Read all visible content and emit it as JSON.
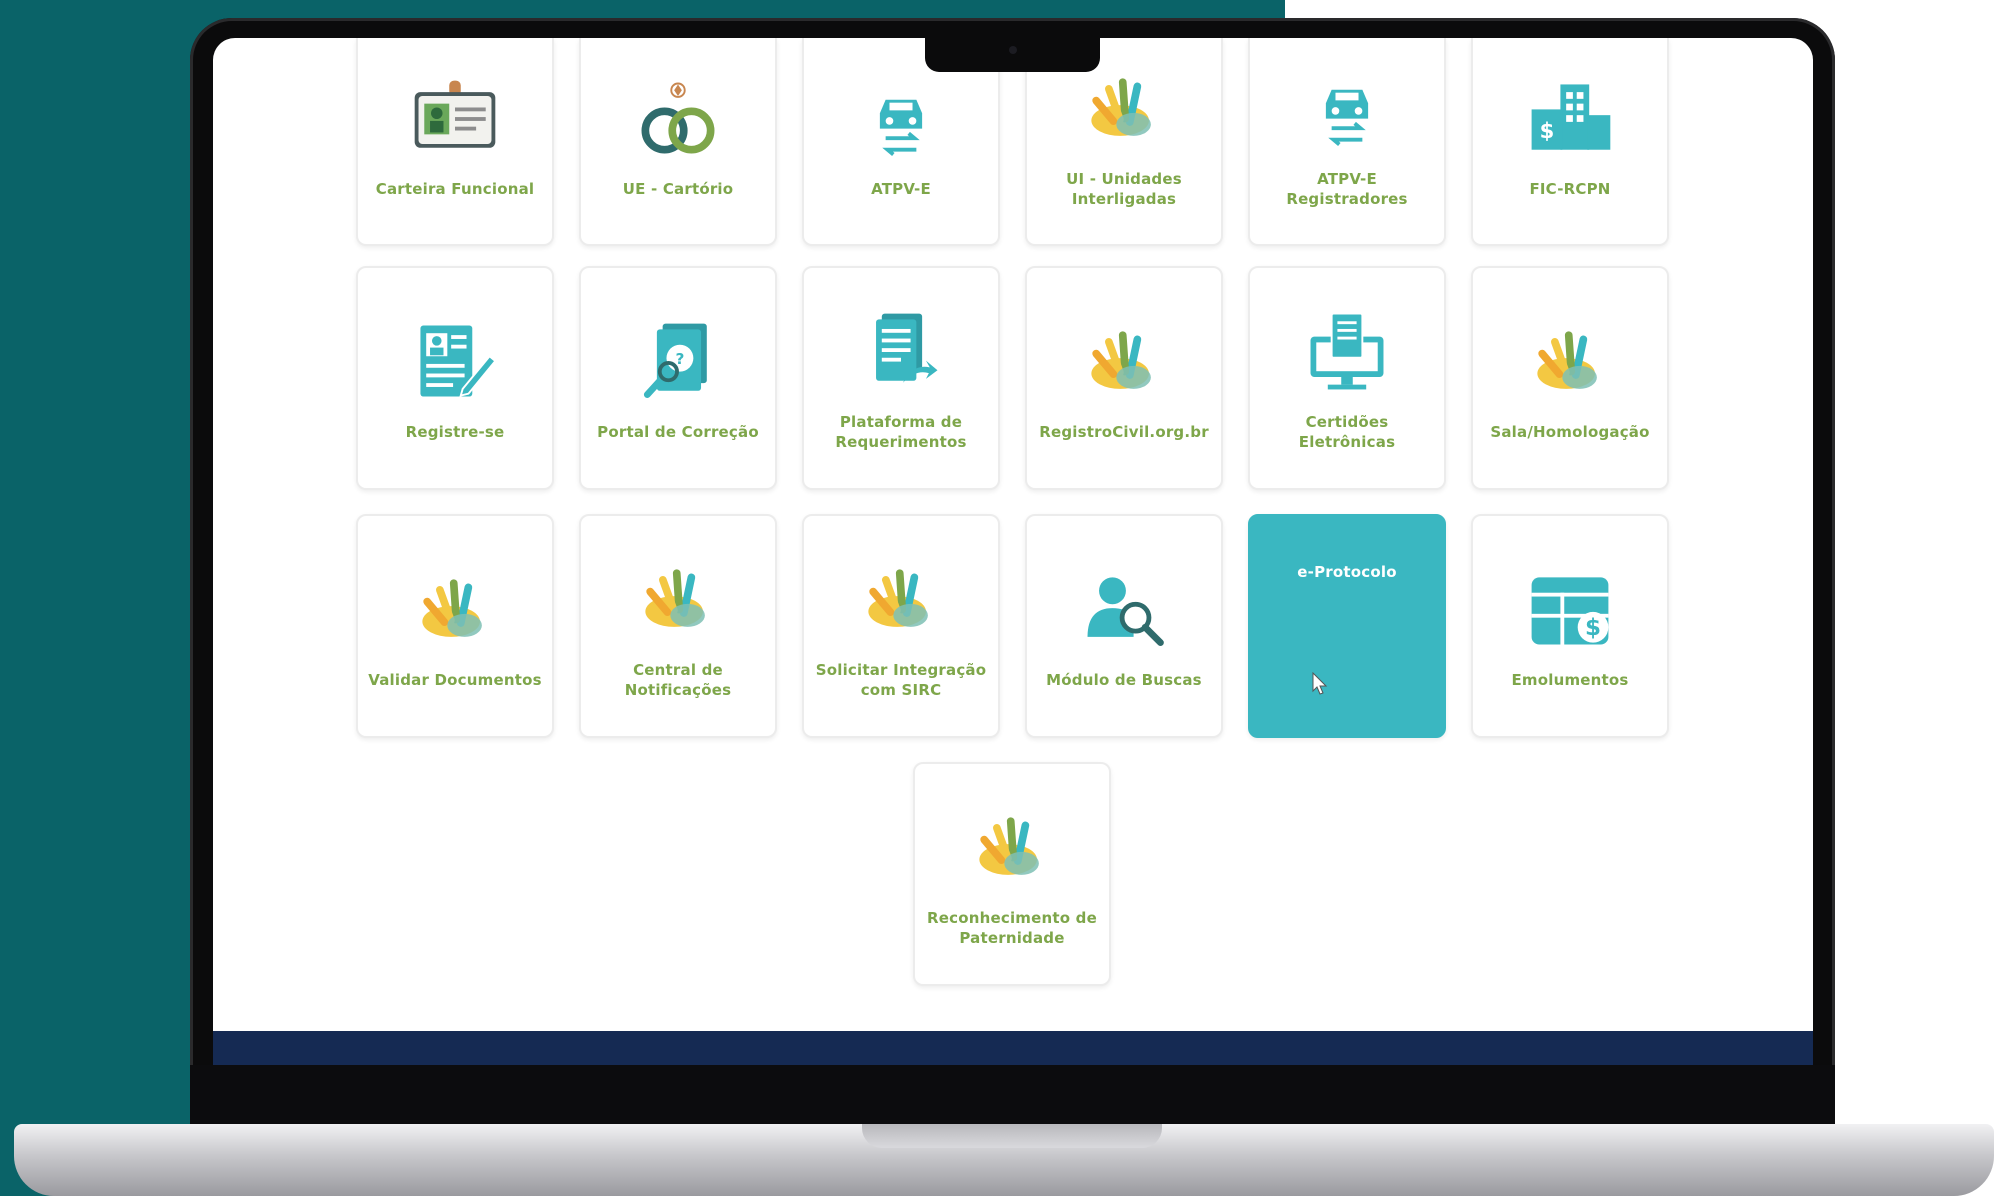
{
  "tiles": [
    {
      "id": "carteira-funcional",
      "label": "Carteira Funcional",
      "icon": "id-badge-icon"
    },
    {
      "id": "ue-cartorio",
      "label": "UE - Cartório",
      "icon": "rings-icon"
    },
    {
      "id": "atpv-e",
      "label": "ATPV-E",
      "icon": "car-transfer-icon"
    },
    {
      "id": "ui-unidades",
      "label": "UI - Unidades Interligadas",
      "icon": "hands-logo-icon"
    },
    {
      "id": "atpv-e-registradores",
      "label": "ATPV-E Registradores",
      "icon": "car-transfer-icon"
    },
    {
      "id": "fic-rcpn",
      "label": "FIC-RCPN",
      "icon": "bank-building-icon"
    },
    {
      "id": "registre-se",
      "label": "Registre-se",
      "icon": "id-form-pen-icon"
    },
    {
      "id": "portal-correcao",
      "label": "Portal de Correção",
      "icon": "document-search-icon"
    },
    {
      "id": "plataforma-requerimentos",
      "label": "Plataforma de Requerimentos",
      "icon": "document-send-icon"
    },
    {
      "id": "registrocivil",
      "label": "RegistroCivil.org.br",
      "icon": "hands-logo-icon"
    },
    {
      "id": "certidoes-eletronicas",
      "label": "Certidões Eletrônicas",
      "icon": "computer-document-icon"
    },
    {
      "id": "sala-homologacao",
      "label": "Sala/Homologação",
      "icon": "hands-logo-icon"
    },
    {
      "id": "validar-documentos",
      "label": "Validar Documentos",
      "icon": "hands-logo-icon"
    },
    {
      "id": "central-notificacoes",
      "label": "Central de Notificações",
      "icon": "hands-logo-icon"
    },
    {
      "id": "solicitar-integracao",
      "label": "Solicitar Integração com SIRC",
      "icon": "hands-logo-icon"
    },
    {
      "id": "modulo-buscas",
      "label": "Módulo de Buscas",
      "icon": "user-search-icon"
    },
    {
      "id": "e-protocolo",
      "label": "e-Protocolo",
      "icon": "none",
      "active": true
    },
    {
      "id": "emolumentos",
      "label": "Emolumentos",
      "icon": "table-dollar-icon"
    },
    {
      "id": "reconhecimento-paternidade",
      "label": "Reconhecimento de Paternidade",
      "icon": "hands-logo-icon"
    }
  ],
  "colors": {
    "accent": "#3ab7c1",
    "label": "#7ea64a",
    "footer": "#152a53",
    "backdrop": "#0a6368"
  }
}
